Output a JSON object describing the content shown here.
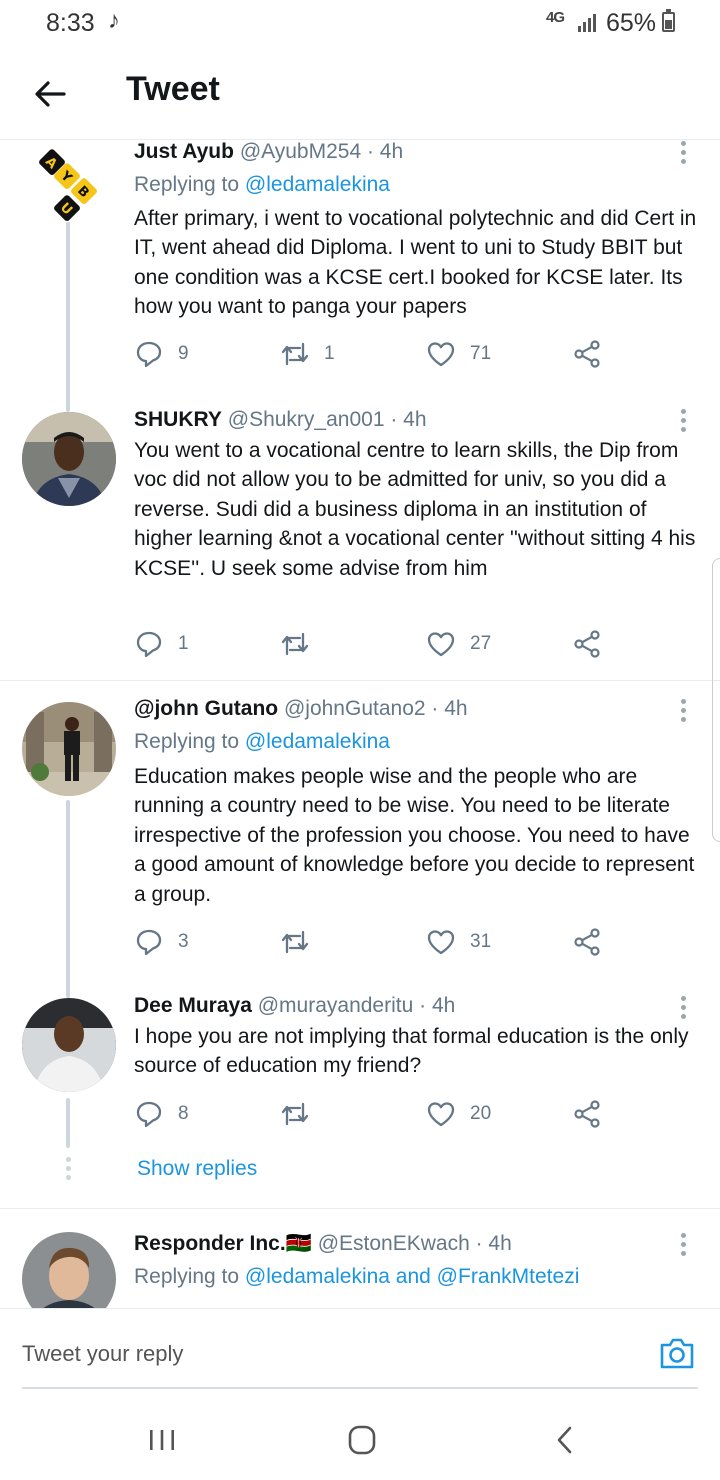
{
  "status_bar": {
    "time": "8:33",
    "network": "4G",
    "battery": "65%"
  },
  "header": {
    "title": "Tweet"
  },
  "tweets": [
    {
      "name": "Just Ayub",
      "handle": "@AyubM254 · 4h",
      "replying_prefix": "Replying to ",
      "replying_to": "@ledamalekina",
      "text": "After primary, i went to vocational polytechnic and did Cert in IT, went ahead did Diploma. I went to uni to Study BBIT but one condition was a KCSE cert.I booked for KCSE later. Its how you want to panga your papers",
      "replies": "9",
      "retweets": "1",
      "likes": "71",
      "avatar_letters": [
        "A",
        "Y",
        "U",
        "B"
      ]
    },
    {
      "name": "SHUKRY",
      "handle": "@Shukry_an001 · 4h",
      "text": "You went to a vocational centre to learn skills, the Dip from voc did not allow you to be admitted for univ, so you did a reverse. Sudi did a business diploma in an institution of higher learning &not a vocational center ''without sitting 4 his KCSE''. U seek some advise from him",
      "replies": "1",
      "retweets": "",
      "likes": "27"
    },
    {
      "name": "@john Gutano",
      "handle": "@johnGutano2 · 4h",
      "replying_prefix": "Replying to ",
      "replying_to": "@ledamalekina",
      "text": "Education makes people wise and the people who are running a country need to be wise. You need to be literate irrespective of the profession you choose. You need to have a good amount of knowledge before you decide to represent a group.",
      "replies": "3",
      "retweets": "",
      "likes": "31"
    },
    {
      "name": "Dee Muraya",
      "handle": "@murayanderitu · 4h",
      "text": "I hope you are not implying that formal education is the only source of education my friend?",
      "replies": "8",
      "retweets": "",
      "likes": "20"
    },
    {
      "name": "Responder Inc.",
      "flag": "🇰🇪",
      "handle": "@EstonEKwach · 4h",
      "replying_prefix": "Replying to ",
      "replying_to": "@ledamalekina and @FrankMtetezi"
    }
  ],
  "show_replies": "Show replies",
  "reply_box": {
    "placeholder": "Tweet your reply"
  },
  "icons": {
    "back": "arrow-left-icon",
    "reply": "reply-icon",
    "retweet": "retweet-icon",
    "like": "heart-icon",
    "share": "share-icon",
    "camera": "camera-icon",
    "more": "more-vertical-icon"
  },
  "colors": {
    "link": "#1b95e0",
    "secondary": "#657786",
    "divider": "#e6ecf0"
  }
}
